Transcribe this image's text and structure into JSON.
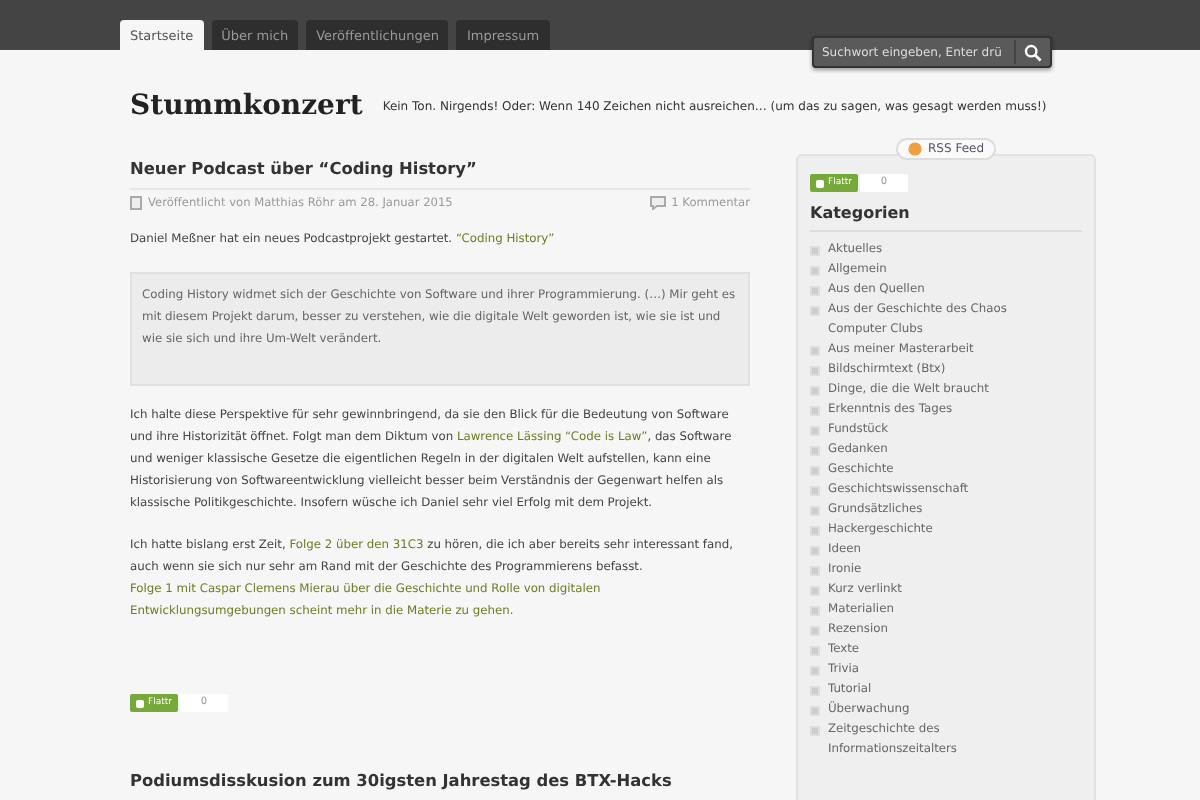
{
  "nav": {
    "tabs": [
      {
        "label": "Startseite",
        "selected": true
      },
      {
        "label": "Über mich",
        "selected": false
      },
      {
        "label": "Veröffentlichungen",
        "selected": false
      },
      {
        "label": "Impressum",
        "selected": false
      }
    ],
    "search": {
      "placeholder": "Suchwort eingeben, Enter drü"
    }
  },
  "header": {
    "site_title": "Stummkonzert",
    "tagline": "Kein Ton. Nirgends! Oder: Wenn 140 Zeichen nicht ausreichen… (um das zu sagen, was gesagt werden muss!)"
  },
  "posts": [
    {
      "title": "Neuer Podcast über “Coding History”",
      "byline": "Veröffentlicht von Matthias Röhr am 28. Januar 2015",
      "comments": "1 Kommentar",
      "blocks": [
        {
          "kind": "paragraph",
          "parts": [
            {
              "kind": "text",
              "text": "Daniel Meßner hat ein neues Podcastprojekt gestartet. "
            },
            {
              "kind": "link",
              "text": "“Coding History”"
            }
          ]
        },
        {
          "kind": "quote",
          "parts": [
            {
              "kind": "text",
              "text": "Coding History widmet sich der Geschichte von Software und ihrer Programmierung. (…) Mir geht es mit diesem Projekt darum, besser zu verstehen, wie die digitale Welt geworden ist, wie sie ist und wie sie sich und ihre Um-Welt verändert."
            }
          ]
        },
        {
          "kind": "paragraph",
          "parts": [
            {
              "kind": "text",
              "text": "Ich halte diese Perspektive für sehr gewinnbringend, da sie den Blick für die Bedeutung von Software und ihre Historizität öffnet. Folgt man dem Diktum von "
            },
            {
              "kind": "link",
              "text": "Lawrence Lässing “Code is"
            },
            {
              "kind": "link",
              "text": "Law”"
            },
            {
              "kind": "text",
              "text": ", das Software und weniger klassische Gesetze die eigentlichen Regeln in der digitalen Welt aufstellen, kann eine Historisierung von Softwareentwicklung vielleicht besser beim Verständnis der Gegenwart helfen als klassische Politikgeschichte. Insofern wüsche ich Daniel sehr viel Erfolg mit dem Projekt."
            }
          ]
        },
        {
          "kind": "paragraph",
          "parts": [
            {
              "kind": "text",
              "text": "Ich hatte bislang erst Zeit, "
            },
            {
              "kind": "link",
              "text": "Folge 2 über den 31C3"
            },
            {
              "kind": "text",
              "text": " zu hören, die ich aber bereits sehr interessant fand, auch wenn sie sich nur sehr am Rand mit der Geschichte des Programmierens befasst. "
            },
            {
              "kind": "link",
              "text": "Folge 1 mit Caspar Clemens Mierau über die Geschichte und Rolle von digitalen"
            },
            {
              "kind": "link",
              "text": "Entwicklungsumgebungen scheint mehr in die Materie zu gehen."
            }
          ]
        }
      ],
      "flattr": {
        "label": "Flattr",
        "count": "0"
      }
    },
    {
      "title": "Podiumsdisskusion zum 30igsten Jahrestag des BTX-Hacks"
    }
  ],
  "sidebar": {
    "rss": "RSS Feed",
    "flattr": {
      "label": "Flattr",
      "count": "0"
    },
    "heading": "Kategorien",
    "categories": [
      "Aktuelles",
      "Allgemein",
      "Aus den Quellen",
      "Aus der Geschichte des Chaos Computer Clubs",
      "Aus meiner Masterarbeit",
      "Bildschirmtext (Btx)",
      "Dinge, die die Welt braucht",
      "Erkenntnis des Tages",
      "Fundstück",
      "Gedanken",
      "Geschichte",
      "Geschichtswissenschaft",
      "Grundsätzliches",
      "Hackergeschichte",
      "Ideen",
      "Ironie",
      "Kurz verlinkt",
      "Materialien",
      "Rezension",
      "Texte",
      "Trivia",
      "Tutorial",
      "Überwachung",
      "Zeitgeschichte des Informationszeitalters"
    ]
  }
}
